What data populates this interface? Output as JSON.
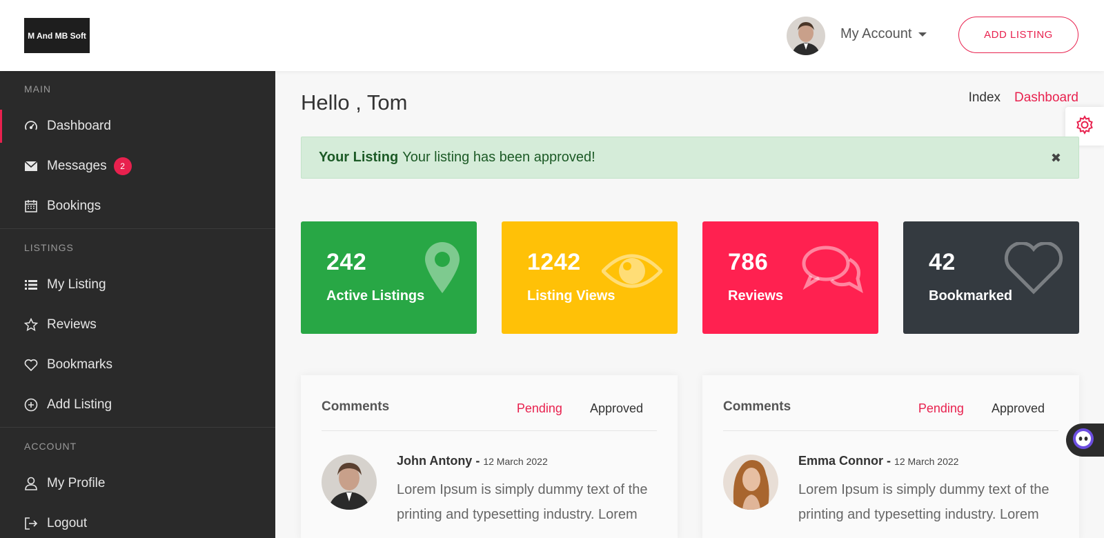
{
  "header": {
    "logo_text": "M And MB Soft",
    "account_label": "My Account",
    "add_listing_label": "ADD LISTING"
  },
  "sidebar": {
    "sections": [
      {
        "title": "MAIN"
      },
      {
        "title": "LISTINGS"
      },
      {
        "title": "ACCOUNT"
      }
    ],
    "items": [
      {
        "label": "Dashboard",
        "icon": "dashboard-gauge-icon"
      },
      {
        "label": "Messages",
        "icon": "envelope-icon",
        "badge": "2"
      },
      {
        "label": "Bookings",
        "icon": "calendar-icon"
      },
      {
        "label": "My Listing",
        "icon": "list-icon"
      },
      {
        "label": "Reviews",
        "icon": "star-icon"
      },
      {
        "label": "Bookmarks",
        "icon": "heart-icon"
      },
      {
        "label": "Add Listing",
        "icon": "plus-circle-icon"
      },
      {
        "label": "My Profile",
        "icon": "user-icon"
      },
      {
        "label": "Logout",
        "icon": "logout-icon"
      }
    ]
  },
  "main": {
    "greeting": "Hello , Tom",
    "breadcrumb": [
      "Index",
      "Dashboard"
    ],
    "alert": {
      "title": "Your Listing",
      "message": "Your listing has been approved!"
    },
    "stats": [
      {
        "value": "242",
        "label": "Active Listings",
        "color": "#28a745",
        "icon": "map-pin-icon"
      },
      {
        "value": "1242",
        "label": "Listing Views",
        "color": "#ffc107",
        "icon": "eye-icon"
      },
      {
        "value": "786",
        "label": "Reviews",
        "color": "#ff2150",
        "icon": "chat-bubbles-icon"
      },
      {
        "value": "42",
        "label": "Bookmarked",
        "color": "#343a40",
        "icon": "heart-icon"
      }
    ],
    "comment_cards": [
      {
        "title": "Comments",
        "tabs": [
          "Pending",
          "Approved"
        ],
        "author": "John Antony -",
        "date": "12 March 2022",
        "text": "Lorem Ipsum is simply dummy text of the printing and typesetting industry. Lorem"
      },
      {
        "title": "Comments",
        "tabs": [
          "Pending",
          "Approved"
        ],
        "author": "Emma Connor -",
        "date": "12 March 2022",
        "text": "Lorem Ipsum is simply dummy text of the printing and typesetting industry. Lorem"
      }
    ]
  },
  "colors": {
    "accent": "#e8214e",
    "sidebar_bg": "#2a2a2a",
    "alert_bg": "#d5ecd9"
  }
}
